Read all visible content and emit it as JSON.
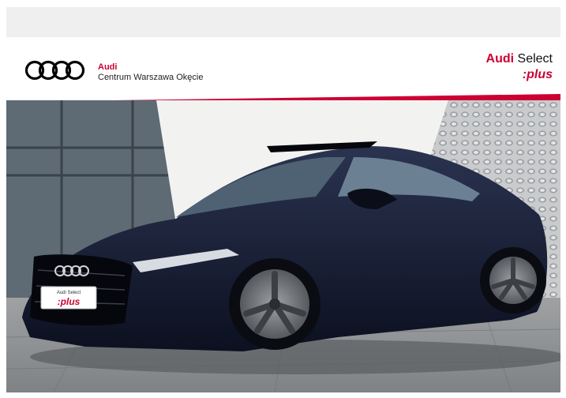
{
  "dealer": {
    "brand": "Audi",
    "name": "Centrum Warszawa Okęcie"
  },
  "program": {
    "brand": "Audi",
    "name": "Select",
    "suffix": ":plus"
  },
  "plate": {
    "line1": "Audi Select",
    "line2": ":plus"
  },
  "colors": {
    "accent": "#cc0033",
    "car_body": "#141a2b",
    "band": "#efefef"
  },
  "icons": {
    "logo": "audi-rings-icon"
  }
}
